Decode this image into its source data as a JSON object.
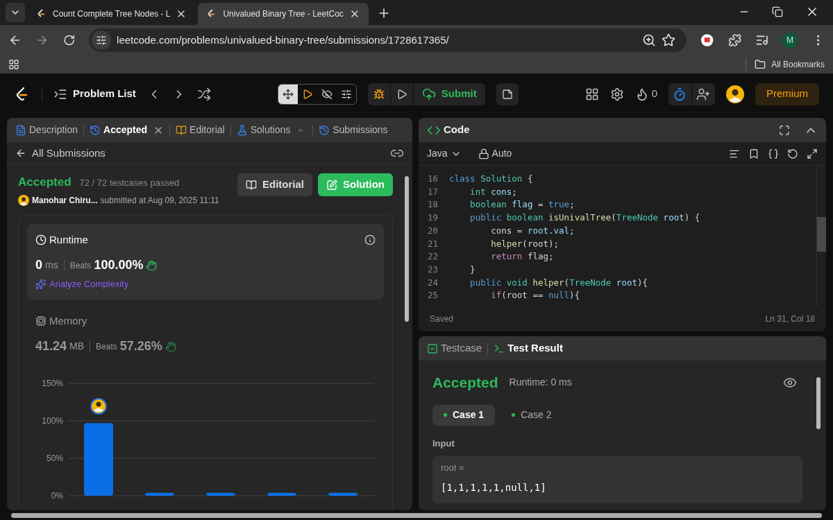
{
  "browser": {
    "tabs": [
      {
        "title": "Count Complete Tree Nodes - L",
        "selected": false
      },
      {
        "title": "Univalued Binary Tree - LeetCoc",
        "selected": true
      }
    ],
    "url": "leetcode.com/problems/univalued-binary-tree/submissions/1728617365/",
    "profile_initial": "M",
    "bookmarks": "All Bookmarks"
  },
  "navbar": {
    "problem_list": "Problem List",
    "submit": "Submit",
    "streak": "0",
    "premium": "Premium"
  },
  "left_panel": {
    "tabs": [
      {
        "label": "Description",
        "selected": false,
        "closable": false,
        "kind": "description"
      },
      {
        "label": "Accepted",
        "selected": true,
        "closable": true,
        "kind": "history"
      },
      {
        "label": "Editorial",
        "selected": false,
        "closable": false,
        "kind": "editorial"
      },
      {
        "label": "Solutions",
        "selected": false,
        "closable": false,
        "kind": "solutions"
      },
      {
        "label": "Submissions",
        "selected": false,
        "closable": false,
        "kind": "history"
      }
    ],
    "back": "All Submissions",
    "status": "Accepted",
    "passed": "72 / 72 testcases passed",
    "author": "Manohar Chiru...",
    "submitted": "submitted at Aug 09, 2025 11:11",
    "buttons": [
      {
        "label": "Editorial",
        "kind": "secondary"
      },
      {
        "label": "Solution",
        "kind": "primary"
      }
    ],
    "metrics": [
      {
        "kind": "runtime",
        "title": "Runtime",
        "selected": true,
        "value": "0",
        "unit": "ms",
        "beats_label": "Beats",
        "beats": "100.00%",
        "link": "Analyze Complexity"
      },
      {
        "kind": "memory",
        "title": "Memory",
        "selected": false,
        "value": "41.24",
        "unit": "MB",
        "beats_label": "Beats",
        "beats": "57.26%"
      }
    ],
    "chart_data": {
      "type": "bar",
      "values": [
        97,
        4,
        4,
        4,
        4
      ],
      "ylim": [
        0,
        150
      ],
      "yticks": [
        {
          "value": 0,
          "label": "0%"
        },
        {
          "value": 50,
          "label": "50%"
        },
        {
          "value": 100,
          "label": "100%"
        },
        {
          "value": 150,
          "label": "150%"
        }
      ]
    }
  },
  "code_panel": {
    "title": "Code",
    "language": "Java",
    "mode": "Auto",
    "status": "Saved",
    "cursor": "Ln 31, Col 18",
    "lines": [
      {
        "number": "16",
        "tokens": [
          {
            "kind": "keyword",
            "text": "class"
          },
          {
            "kind": "type",
            "text": " Solution"
          },
          {
            "kind": "plain",
            "text": " {"
          }
        ]
      },
      {
        "number": "17",
        "tokens": [
          {
            "kind": "type",
            "text": "    int"
          },
          {
            "kind": "variable",
            "text": " cons"
          },
          {
            "kind": "plain",
            "text": ";"
          }
        ]
      },
      {
        "number": "18",
        "tokens": [
          {
            "kind": "type",
            "text": "    boolean"
          },
          {
            "kind": "variable",
            "text": " flag"
          },
          {
            "kind": "plain",
            "text": " = "
          },
          {
            "kind": "keyword",
            "text": "true"
          },
          {
            "kind": "plain",
            "text": ";"
          }
        ]
      },
      {
        "number": "19",
        "tokens": [
          {
            "kind": "keyword",
            "text": "    public"
          },
          {
            "kind": "type",
            "text": " boolean"
          },
          {
            "kind": "function",
            "text": " isUnivalTree"
          },
          {
            "kind": "plain",
            "text": "("
          },
          {
            "kind": "type",
            "text": "TreeNode"
          },
          {
            "kind": "variable",
            "text": " root"
          },
          {
            "kind": "plain",
            "text": ") {"
          }
        ]
      },
      {
        "number": "20",
        "tokens": [
          {
            "kind": "plain",
            "text": "        cons = "
          },
          {
            "kind": "variable",
            "text": "root"
          },
          {
            "kind": "plain",
            "text": "."
          },
          {
            "kind": "variable",
            "text": "val"
          },
          {
            "kind": "plain",
            "text": ";"
          }
        ]
      },
      {
        "number": "21",
        "tokens": [
          {
            "kind": "function",
            "text": "        helper"
          },
          {
            "kind": "plain",
            "text": "(root);"
          }
        ]
      },
      {
        "number": "22",
        "tokens": [
          {
            "kind": "control",
            "text": "        return"
          },
          {
            "kind": "plain",
            "text": " flag;"
          }
        ]
      },
      {
        "number": "23",
        "tokens": [
          {
            "kind": "plain",
            "text": "    }"
          }
        ]
      },
      {
        "number": "24",
        "tokens": [
          {
            "kind": "keyword",
            "text": "    public"
          },
          {
            "kind": "type",
            "text": " void"
          },
          {
            "kind": "function",
            "text": " helper"
          },
          {
            "kind": "plain",
            "text": "("
          },
          {
            "kind": "type",
            "text": "TreeNode"
          },
          {
            "kind": "variable",
            "text": " root"
          },
          {
            "kind": "plain",
            "text": "){"
          }
        ]
      },
      {
        "number": "25",
        "tokens": [
          {
            "kind": "control",
            "text": "        if"
          },
          {
            "kind": "plain",
            "text": "(root == "
          },
          {
            "kind": "keyword",
            "text": "null"
          },
          {
            "kind": "plain",
            "text": "){"
          }
        ]
      }
    ]
  },
  "test_panel": {
    "tabs": [
      {
        "label": "Testcase",
        "selected": false,
        "kind": "testcase"
      },
      {
        "label": "Test Result",
        "selected": true,
        "kind": "terminal"
      }
    ],
    "result": "Accepted",
    "runtime": "Runtime: 0 ms",
    "cases": [
      {
        "label": "Case 1",
        "selected": true
      },
      {
        "label": "Case 2",
        "selected": false
      }
    ],
    "input_label": "Input",
    "param": "root =",
    "value": "[1,1,1,1,1,null,1]"
  }
}
